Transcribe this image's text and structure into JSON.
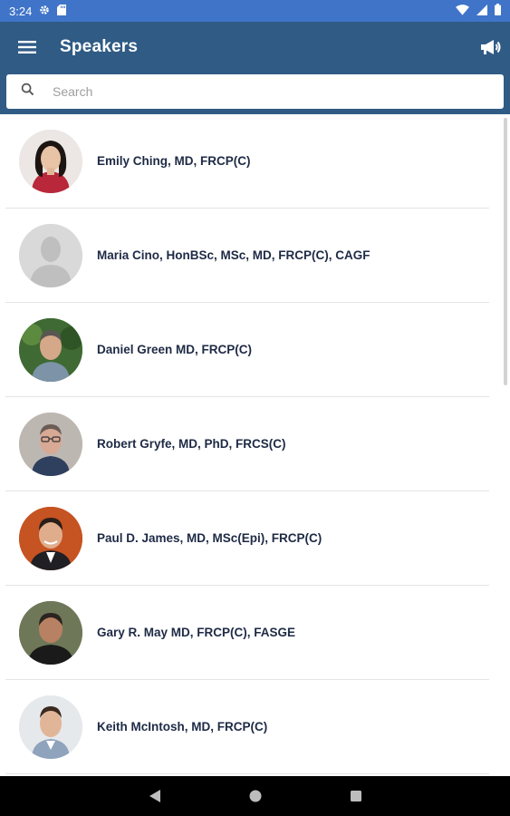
{
  "status_bar": {
    "time": "3:24"
  },
  "app_bar": {
    "title": "Speakers"
  },
  "search": {
    "placeholder": "Search"
  },
  "speakers": [
    {
      "name": "Emily Ching, MD, FRCP(C)"
    },
    {
      "name": "Maria Cino, HonBSc, MSc, MD, FRCP(C), CAGF"
    },
    {
      "name": "Daniel Green MD, FRCP(C)"
    },
    {
      "name": "Robert Gryfe, MD, PhD, FRCS(C)"
    },
    {
      "name": "Paul D. James, MD, MSc(Epi), FRCP(C)"
    },
    {
      "name": "Gary R. May MD, FRCP(C), FASGE"
    },
    {
      "name": "Keith McIntosh, MD, FRCP(C)"
    }
  ],
  "colors": {
    "status_bar": "#3f74c9",
    "app_bar": "#2f5b85",
    "name_text": "#1e2a45",
    "nav_bar": "#000000"
  }
}
